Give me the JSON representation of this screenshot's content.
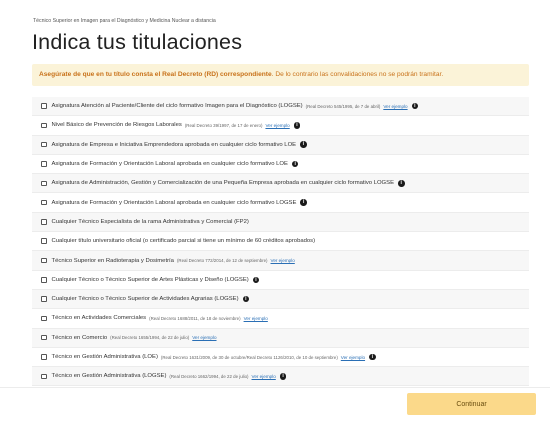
{
  "breadcrumb": "Técnico Superior en Imagen para el Diagnóstico y Medicina Nuclear a distancia",
  "title": "Indica tus titulaciones",
  "notice": {
    "bold": "Asegúrate de que en tu título consta el Real Decreto (RD) correspondiente",
    "rest": ". De lo contrario las convalidaciones no se podrán tramitar."
  },
  "items": [
    {
      "label": "Asignatura Atención al Paciente/Cliente del ciclo formativo Imagen para el Diagnóstico (LOGSE)",
      "small": "(Real Decreto 545/1995, de 7 de abril)",
      "link": "Ver ejemplo",
      "info": true
    },
    {
      "label": "Nivel Básico de Prevención de Riesgos Laborales",
      "small": "(Real Decreto 39/1997, de 17 de enero)",
      "link": "Ver ejemplo",
      "info": true
    },
    {
      "label": "Asignatura de Empresa e Iniciativa Emprendedora aprobada en cualquier ciclo formativo LOE",
      "small": "",
      "link": "",
      "info": true
    },
    {
      "label": "Asignatura de Formación y Orientación Laboral aprobada en cualquier ciclo formativo LOE",
      "small": "",
      "link": "",
      "info": true
    },
    {
      "label": "Asignatura de Administración, Gestión y Comercialización de una Pequeña Empresa aprobada en cualquier ciclo formativo LOGSE",
      "small": "",
      "link": "",
      "info": true
    },
    {
      "label": "Asignatura de Formación y Orientación Laboral aprobada en cualquier ciclo formativo LOGSE",
      "small": "",
      "link": "",
      "info": true
    },
    {
      "label": "Cualquier Técnico Especialista de la rama Administrativa y Comercial (FP2)",
      "small": "",
      "link": "",
      "info": false
    },
    {
      "label": "Cualquier título universitario oficial (o certificado parcial si tiene un mínimo de 60 créditos aprobados)",
      "small": "",
      "link": "",
      "info": false
    },
    {
      "label": "Técnico Superior en Radioterapia y Dosimetría",
      "small": "(Real Decreto 772/2014, de 12 de septiembre)",
      "link": "Ver ejemplo",
      "info": false
    },
    {
      "label": "Cualquier Técnico o Técnico Superior de Artes Plásticas y Diseño (LOGSE)",
      "small": "",
      "link": "",
      "info": true
    },
    {
      "label": "Cualquier Técnico o Técnico Superior de Actividades Agrarias (LOGSE)",
      "small": "",
      "link": "",
      "info": true
    },
    {
      "label": "Técnico en Actividades Comerciales",
      "small": "(Real Decreto 1688/2011, de 18 de noviembre)",
      "link": "Ver ejemplo",
      "info": false
    },
    {
      "label": "Técnico en Comercio",
      "small": "(Real Decreto 1655/1994, de 22 de julio)",
      "link": "Ver ejemplo",
      "info": false
    },
    {
      "label": "Técnico en Gestión Administrativa (LOE)",
      "small": "(Real Decreto 1631/2009, de 30 de octubre/Real Decreto 1126/2010, de 10 de septiembre)",
      "link": "Ver ejemplo",
      "info": true
    },
    {
      "label": "Técnico en Gestión Administrativa (LOGSE)",
      "small": "(Real Decreto 1662/1994, de 22 de julio)",
      "link": "Ver ejemplo",
      "info": true
    }
  ],
  "continue_label": "Continuar",
  "info_glyph": "i"
}
